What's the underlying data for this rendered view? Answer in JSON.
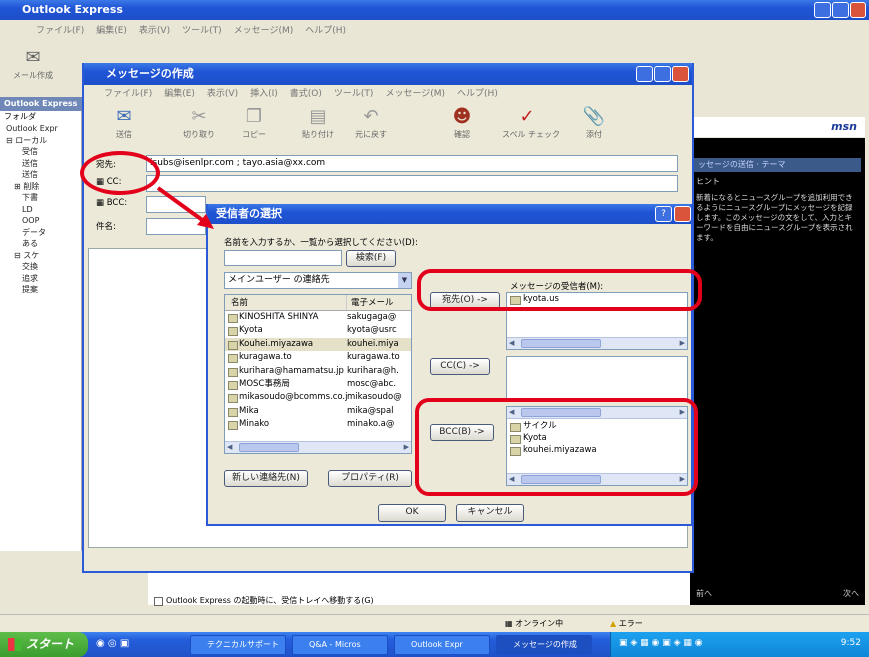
{
  "colors": {
    "xp_blue": "#2158d8",
    "annotation_red": "#e3001b",
    "taskbar": "#245edb",
    "start_green": "#3a9d2e"
  },
  "main_window": {
    "title": "Outlook Express",
    "menu": [
      "ファイル(F)",
      "編集(E)",
      "表示(V)",
      "ツール(T)",
      "メッセージ(M)",
      "ヘルプ(H)"
    ],
    "create_mail": "メール作成",
    "folder_header": "Outlook Express",
    "folder_label": "フォルダ",
    "tree": [
      "Outlook Expr",
      "⊟ ローカル",
      "受信",
      "送信",
      "送信",
      "⊞ 削除",
      "下書",
      "LD",
      "OOP",
      "データ",
      "ある",
      "⊟ スケ",
      "交換",
      "追求",
      "提案"
    ],
    "msn_text": "msn",
    "panel_header": "ッセージの送信 · テーマ",
    "panel_label": "ヒント",
    "panel_tip": "新着になるとニュースグループを追加利用できるようにニュースグループにメッセージを記録します。このメッセージの文をして、入力とキーワードを自由にニュースグループを表示されます。",
    "footer_checkbox": "Outlook Express の起動時に、受信トレイへ移動する(G)",
    "nav_prev": "前へ",
    "nav_next": "次へ"
  },
  "statusbar": {
    "online": "オンライン中",
    "error": "エラー"
  },
  "compose_window": {
    "title": "メッセージの作成",
    "menu": [
      "ファイル(F)",
      "編集(E)",
      "表示(V)",
      "挿入(I)",
      "書式(O)",
      "ツール(T)",
      "メッセージ(M)",
      "ヘルプ(H)"
    ],
    "toolbar": [
      {
        "label": "送信",
        "icon": "send-icon"
      },
      {
        "label": "切り取り",
        "icon": "cut-icon"
      },
      {
        "label": "コピー",
        "icon": "copy-icon"
      },
      {
        "label": "貼り付け",
        "icon": "paste-icon"
      },
      {
        "label": "元に戻す",
        "icon": "undo-icon"
      },
      {
        "label": "確認",
        "icon": "check-names-icon"
      },
      {
        "label": "スペル チェック",
        "icon": "spell-check-icon"
      },
      {
        "label": "添付",
        "icon": "attach-icon"
      }
    ],
    "to_label": "宛先:",
    "to_value": "isubs@isenlpr.com ; tayo.asia@xx.com",
    "cc_label": "CC:",
    "subject_label": "件名:",
    "bcc_label": "BCC:"
  },
  "dialog": {
    "title": "受信者の選択",
    "instruction": "名前を入力するか、一覧から選択してください(D):",
    "search_button": "検索(F)",
    "source_select": "メインユーザー の連絡先",
    "col_name": "名前",
    "col_email": "電子メール",
    "contacts": [
      {
        "name": "KINOSHITA SHINYA",
        "email": "sakugaga@"
      },
      {
        "name": "Kyota",
        "email": "kyota@usrc"
      },
      {
        "name": "Kouhei.miyazawa",
        "email": "kouhei.miya"
      },
      {
        "name": "kuragawa.to",
        "email": "kuragawa.to"
      },
      {
        "name": "kurihara@hamamatsu.jp",
        "email": "kurihara@h."
      },
      {
        "name": "MOSC事務局",
        "email": "mosc@abc."
      },
      {
        "name": "mikasoudo@bcomms.co.jp",
        "email": "mikasoudo@"
      },
      {
        "name": "Mika",
        "email": "mika@spal"
      },
      {
        "name": "Minako",
        "email": "minako.a@"
      }
    ],
    "new_contact_button": "新しい連絡先(N)",
    "properties_button": "プロパティ(R)",
    "recipients_label": "メッセージの受信者(M):",
    "to_button": "宛先(O) ->",
    "cc_button": "CC(C) ->",
    "bcc_button": "BCC(B) ->",
    "to_recipients": [
      "kyota.us"
    ],
    "bcc_recipients": [
      "サイクル",
      "Kyota",
      "kouhei.miyazawa"
    ],
    "ok_button": "OK",
    "cancel_button": "キャンセル"
  },
  "taskbar": {
    "start": "スタート",
    "buttons": [
      "テクニカルサポート",
      "Q&A - Micros",
      "Outlook Expr",
      "メッセージの作成"
    ],
    "clock": "9:52"
  }
}
